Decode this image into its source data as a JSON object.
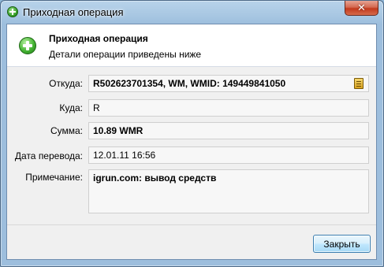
{
  "window": {
    "title": "Приходная операция",
    "close_glyph": "✕"
  },
  "header": {
    "title": "Приходная операция",
    "subtitle": "Детали операции приведены ниже",
    "icon": "add-circle-icon"
  },
  "fields": {
    "from_label": "Откуда:",
    "from_value": "R502623701354, WM, WMID: 149449841050",
    "to_label": "Куда:",
    "to_value": "R",
    "amount_label": "Сумма:",
    "amount_value": "10.89 WMR",
    "date_label": "Дата перевода:",
    "date_value": "12.01.11 16:56",
    "note_label": "Примечание:",
    "note_value": "igrun.com: вывод средств"
  },
  "footer": {
    "close_label": "Закрыть"
  },
  "colors": {
    "titlebar": "#a7c6e2",
    "client_bg": "#f0f0f0",
    "accent_green": "#2f9a22",
    "close_red": "#c2391c"
  }
}
